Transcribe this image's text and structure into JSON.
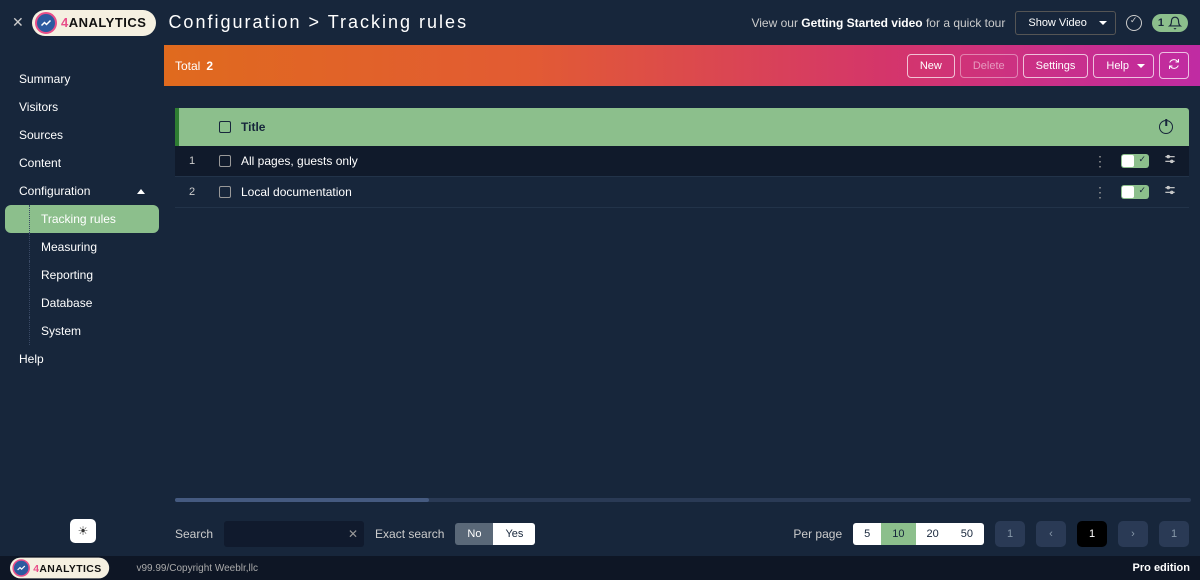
{
  "header": {
    "brand_prefix": "4",
    "brand_rest": "ANALYTICS",
    "breadcrumb": "Configuration > Tracking rules",
    "tour_prefix": "View our ",
    "tour_bold": "Getting Started video",
    "tour_suffix": " for a quick tour",
    "show_video_label": "Show Video",
    "notif_count": "1"
  },
  "sidebar": {
    "items": [
      {
        "label": "Summary"
      },
      {
        "label": "Visitors"
      },
      {
        "label": "Sources"
      },
      {
        "label": "Content"
      },
      {
        "label": "Configuration",
        "expanded": true
      },
      {
        "label": "Help"
      }
    ],
    "config_children": [
      {
        "label": "Tracking rules",
        "active": true
      },
      {
        "label": "Measuring"
      },
      {
        "label": "Reporting"
      },
      {
        "label": "Database"
      },
      {
        "label": "System"
      }
    ]
  },
  "action_bar": {
    "total_label": "Total",
    "total_count": "2",
    "buttons": {
      "new": "New",
      "delete": "Delete",
      "settings": "Settings",
      "help": "Help"
    }
  },
  "table": {
    "columns": {
      "title": "Title"
    },
    "rows": [
      {
        "index": "1",
        "title": "All pages, guests only"
      },
      {
        "index": "2",
        "title": "Local documentation"
      }
    ]
  },
  "pager": {
    "search_label": "Search",
    "exact_label": "Exact search",
    "exact_no": "No",
    "exact_yes": "Yes",
    "per_page_label": "Per page",
    "per_page_options": [
      "5",
      "10",
      "20",
      "50"
    ],
    "per_page_active": "10",
    "first_page": "1",
    "current_page": "1",
    "last_page": "1"
  },
  "footer": {
    "version": "v99.99",
    "sep": " / ",
    "copyright": "Copyright Weeblr,llc",
    "edition": "Pro edition"
  }
}
